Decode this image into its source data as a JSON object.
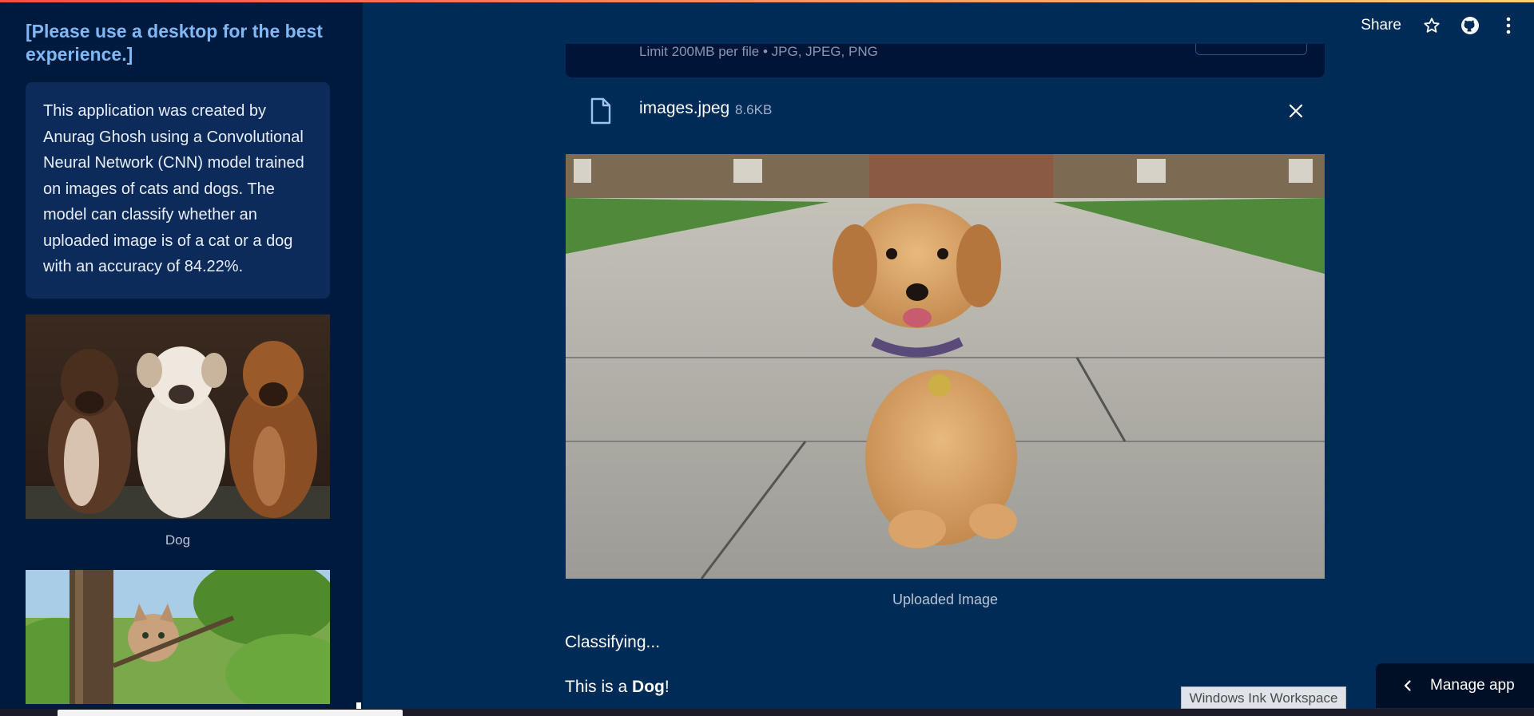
{
  "sidebar": {
    "heading": "[Please use a desktop for the best experience.]",
    "info": "This application was created by Anurag Ghosh using a Convolutional Neural Network (CNN) model trained on images of cats and dogs. The model can classify whether an uploaded image is of a cat or a dog with an accuracy of 84.22%.",
    "image1_caption": "Dog"
  },
  "header": {
    "share_label": "Share",
    "icons": [
      "star-icon",
      "github-icon",
      "more-vertical-icon"
    ]
  },
  "uploader": {
    "limit_text": "Limit 200MB per file • JPG, JPEG, PNG"
  },
  "file": {
    "name": "images.jpeg",
    "size": "8.6KB"
  },
  "main": {
    "image_caption": "Uploaded Image",
    "status_classifying": "Classifying...",
    "result_prefix": "This is a ",
    "result_label": "Dog",
    "result_suffix": "!"
  },
  "manage": {
    "label": "Manage app"
  },
  "os": {
    "ink_tooltip": "Windows Ink Workspace"
  },
  "colors": {
    "main_bg": "#002b57",
    "sidebar_bg": "#001a3d",
    "heading_color": "#7fb8f5",
    "info_bg": "#0c2a5a"
  }
}
